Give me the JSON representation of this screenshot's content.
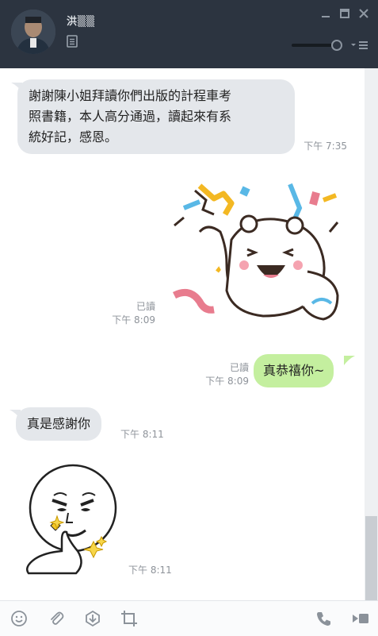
{
  "header": {
    "contact_name": "洪▒▒",
    "avatar_label": "contact photo"
  },
  "messages": [
    {
      "direction": "in",
      "type": "text",
      "text_lines": [
        "謝謝陳小姐拜讀你們出版的計程車考",
        "照書籍，本人高分通過，讀起來有系",
        "統好記，感恩。"
      ],
      "time": "下午 7:35"
    },
    {
      "direction": "out",
      "type": "sticker",
      "sticker": "celebration-bear-sticker",
      "read": "已讀",
      "time": "下午 8:09"
    },
    {
      "direction": "out",
      "type": "text",
      "text": "真恭禧你~",
      "read": "已讀",
      "time": "下午 8:09"
    },
    {
      "direction": "in",
      "type": "text",
      "text": "真是感謝你",
      "time": "下午 8:11"
    },
    {
      "direction": "in",
      "type": "sticker",
      "sticker": "thumbs-up-face-sticker",
      "time": "下午 8:11"
    }
  ],
  "colors": {
    "header_bg": "#2c3440",
    "incoming_bubble": "#e4e7eb",
    "outgoing_bubble": "#c4ef9f"
  },
  "footer_icons": [
    "emoji-icon",
    "attach-icon",
    "download-icon",
    "crop-icon",
    "phone-icon",
    "video-icon"
  ]
}
